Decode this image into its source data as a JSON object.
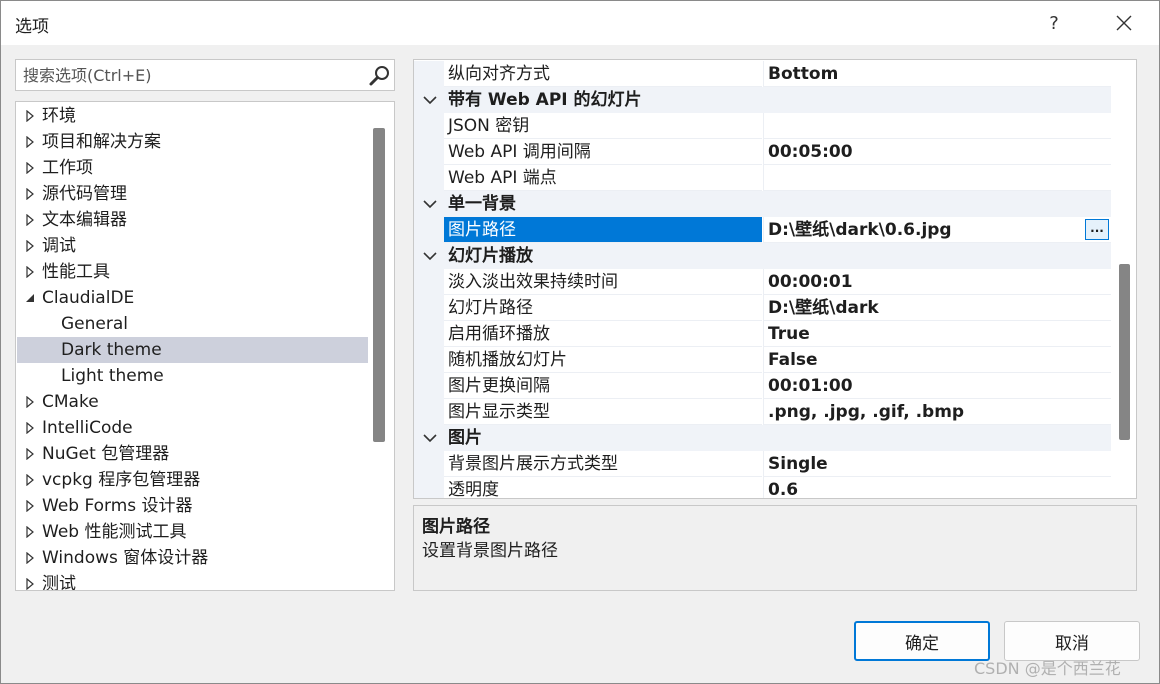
{
  "window": {
    "title": "选项",
    "help_label": "?",
    "close_label": "✕"
  },
  "search": {
    "placeholder": "搜索选项(Ctrl+E)"
  },
  "tree": {
    "items": [
      {
        "label": "环境",
        "state": "collapsed"
      },
      {
        "label": "项目和解决方案",
        "state": "collapsed"
      },
      {
        "label": "工作项",
        "state": "collapsed"
      },
      {
        "label": "源代码管理",
        "state": "collapsed"
      },
      {
        "label": "文本编辑器",
        "state": "collapsed"
      },
      {
        "label": "调试",
        "state": "collapsed"
      },
      {
        "label": "性能工具",
        "state": "collapsed"
      },
      {
        "label": "ClaudialDE",
        "state": "expanded"
      },
      {
        "label": "General",
        "state": "child"
      },
      {
        "label": "Dark theme",
        "state": "child-selected"
      },
      {
        "label": "Light theme",
        "state": "child"
      },
      {
        "label": "CMake",
        "state": "collapsed"
      },
      {
        "label": "IntelliCode",
        "state": "collapsed"
      },
      {
        "label": "NuGet 包管理器",
        "state": "collapsed"
      },
      {
        "label": "vcpkg 程序包管理器",
        "state": "collapsed"
      },
      {
        "label": "Web Forms 设计器",
        "state": "collapsed"
      },
      {
        "label": "Web 性能测试工具",
        "state": "collapsed"
      },
      {
        "label": "Windows 窗体设计器",
        "state": "collapsed"
      },
      {
        "label": "测试",
        "state": "collapsed"
      }
    ]
  },
  "properties": {
    "rows": [
      {
        "type": "prop",
        "name": "纵向对齐方式",
        "value": "Bottom"
      },
      {
        "type": "category",
        "name": "带有 Web API 的幻灯片"
      },
      {
        "type": "prop",
        "name": "JSON 密钥",
        "value": ""
      },
      {
        "type": "prop",
        "name": "Web API 调用间隔",
        "value": "00:05:00"
      },
      {
        "type": "prop",
        "name": "Web API 端点",
        "value": ""
      },
      {
        "type": "category",
        "name": "单一背景"
      },
      {
        "type": "prop",
        "name": "图片路径",
        "value": "D:\\壁纸\\dark\\0.6.jpg",
        "selected": true,
        "button": "..."
      },
      {
        "type": "category",
        "name": "幻灯片播放"
      },
      {
        "type": "prop",
        "name": "淡入淡出效果持续时间",
        "value": "00:00:01"
      },
      {
        "type": "prop",
        "name": "幻灯片路径",
        "value": "D:\\壁纸\\dark"
      },
      {
        "type": "prop",
        "name": "启用循环播放",
        "value": "True"
      },
      {
        "type": "prop",
        "name": "随机播放幻灯片",
        "value": "False"
      },
      {
        "type": "prop",
        "name": "图片更换间隔",
        "value": "00:01:00"
      },
      {
        "type": "prop",
        "name": "图片显示类型",
        "value": ".png, .jpg, .gif, .bmp"
      },
      {
        "type": "category",
        "name": "图片"
      },
      {
        "type": "prop",
        "name": "背景图片展示方式类型",
        "value": "Single"
      },
      {
        "type": "prop",
        "name": "透明度",
        "value": "0.6"
      }
    ]
  },
  "description": {
    "title": "图片路径",
    "text": "设置背景图片路径"
  },
  "buttons": {
    "ok": "确定",
    "cancel": "取消"
  },
  "watermark": "CSDN @是个西兰花",
  "colors": {
    "selection": "#0078d7",
    "tree_selection": "#cdd0dc",
    "category_bg": "#f0f3f8"
  }
}
